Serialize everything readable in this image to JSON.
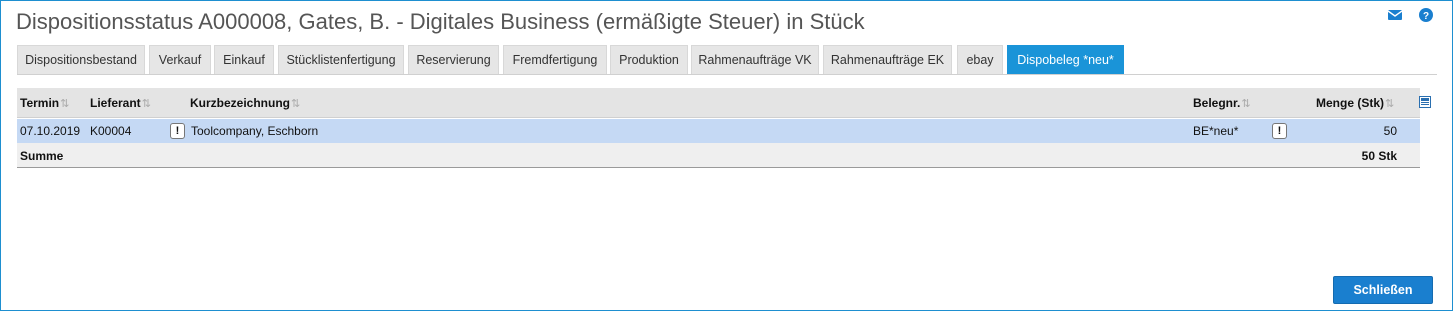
{
  "window": {
    "title": "Dispositionsstatus A000008, Gates, B. - Digitales Business (ermäßigte Steuer) in Stück"
  },
  "header_icons": [
    "mail-icon",
    "help-icon"
  ],
  "tabs": [
    {
      "label": "Dispositionsbestand"
    },
    {
      "label": "Verkauf"
    },
    {
      "label": "Einkauf"
    },
    {
      "label": "Stücklistenfertigung"
    },
    {
      "label": "Reservierung"
    },
    {
      "label": "Fremdfertigung"
    },
    {
      "label": "Produktion"
    },
    {
      "label": "Rahmenaufträge VK"
    },
    {
      "label": "Rahmenaufträge EK"
    },
    {
      "label": "ebay"
    },
    {
      "label": "Dispobeleg *neu*",
      "active": true
    }
  ],
  "table": {
    "columns": {
      "termin": "Termin",
      "lieferant": "Lieferant",
      "kurzbezeichnung": "Kurzbezeichnung",
      "belegnr": "Belegnr.",
      "menge": "Menge (Stk)"
    },
    "rows": [
      {
        "termin": "07.10.2019",
        "lieferant": "K00004",
        "lieferant_info": "!",
        "kurzbezeichnung": "Toolcompany, Eschborn",
        "belegnr": "BE*neu*",
        "belegnr_info": "!",
        "menge": "50"
      }
    ],
    "summary": {
      "label": "Summe",
      "menge": "50 Stk"
    }
  },
  "footer": {
    "close_label": "Schließen"
  },
  "colors": {
    "accent": "#1a94d8",
    "button": "#1a7fcf",
    "selected_row": "#c5d9f4",
    "border": "#1e8fd0"
  }
}
